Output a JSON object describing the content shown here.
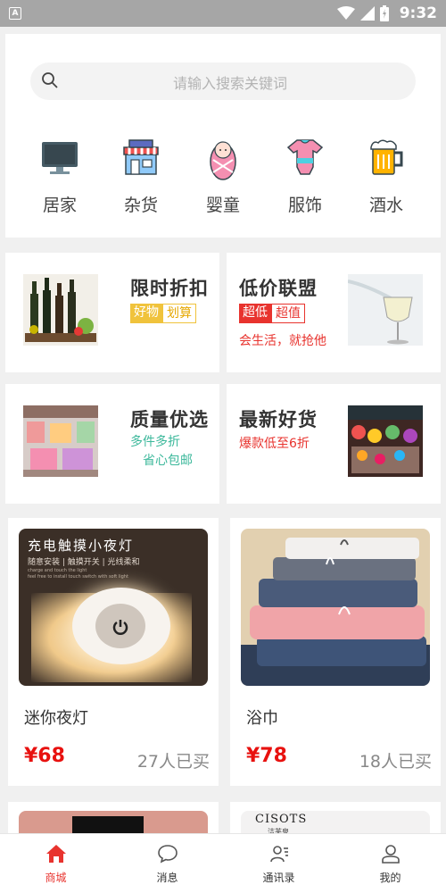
{
  "status_bar": {
    "time": "9:32",
    "app_icon_letter": "A"
  },
  "search": {
    "placeholder": "请输入搜索关键词"
  },
  "categories": [
    {
      "label": "居家",
      "icon": "monitor-icon"
    },
    {
      "label": "杂货",
      "icon": "store-icon"
    },
    {
      "label": "婴童",
      "icon": "baby-icon"
    },
    {
      "label": "服饰",
      "icon": "onesie-icon"
    },
    {
      "label": "酒水",
      "icon": "beer-icon"
    }
  ],
  "promos": {
    "discount": {
      "title": "限时折扣",
      "tags": [
        "好物",
        "划算"
      ]
    },
    "alliance": {
      "title": "低价联盟",
      "tags": [
        "超低",
        "超值"
      ],
      "subtitle": "会生活，就抢他"
    },
    "quality": {
      "title": "质量优选",
      "sub1": "多件多折",
      "sub2": "省心包邮"
    },
    "new": {
      "title": "最新好货",
      "subtitle": "爆款低至6折"
    }
  },
  "products": [
    {
      "name": "迷你夜灯",
      "price": "¥68",
      "sold": "27人已买",
      "img_title": "充电触摸小夜灯",
      "img_sub": "随意安装 | 触摸开关 | 光线柔和",
      "img_tiny1": "charge and touch the light",
      "img_tiny2": "feel free to install  touch switch with soft light"
    },
    {
      "name": "浴巾",
      "price": "¥78",
      "sold": "18人已买"
    }
  ],
  "partial_products": [
    {
      "brand": "CISOTS",
      "brand_sub": "洁芙泉"
    }
  ],
  "bottom_nav": [
    {
      "label": "商城",
      "icon": "home-icon",
      "active": true
    },
    {
      "label": "消息",
      "icon": "chat-icon",
      "active": false
    },
    {
      "label": "通讯录",
      "icon": "contacts-icon",
      "active": false
    },
    {
      "label": "我的",
      "icon": "user-icon",
      "active": false
    }
  ],
  "colors": {
    "accent_red": "#e8332e",
    "price_red": "#e8110f",
    "tag_yellow": "#f0c33c",
    "green": "#3cb89b",
    "status_gray": "#a6a6a6"
  }
}
